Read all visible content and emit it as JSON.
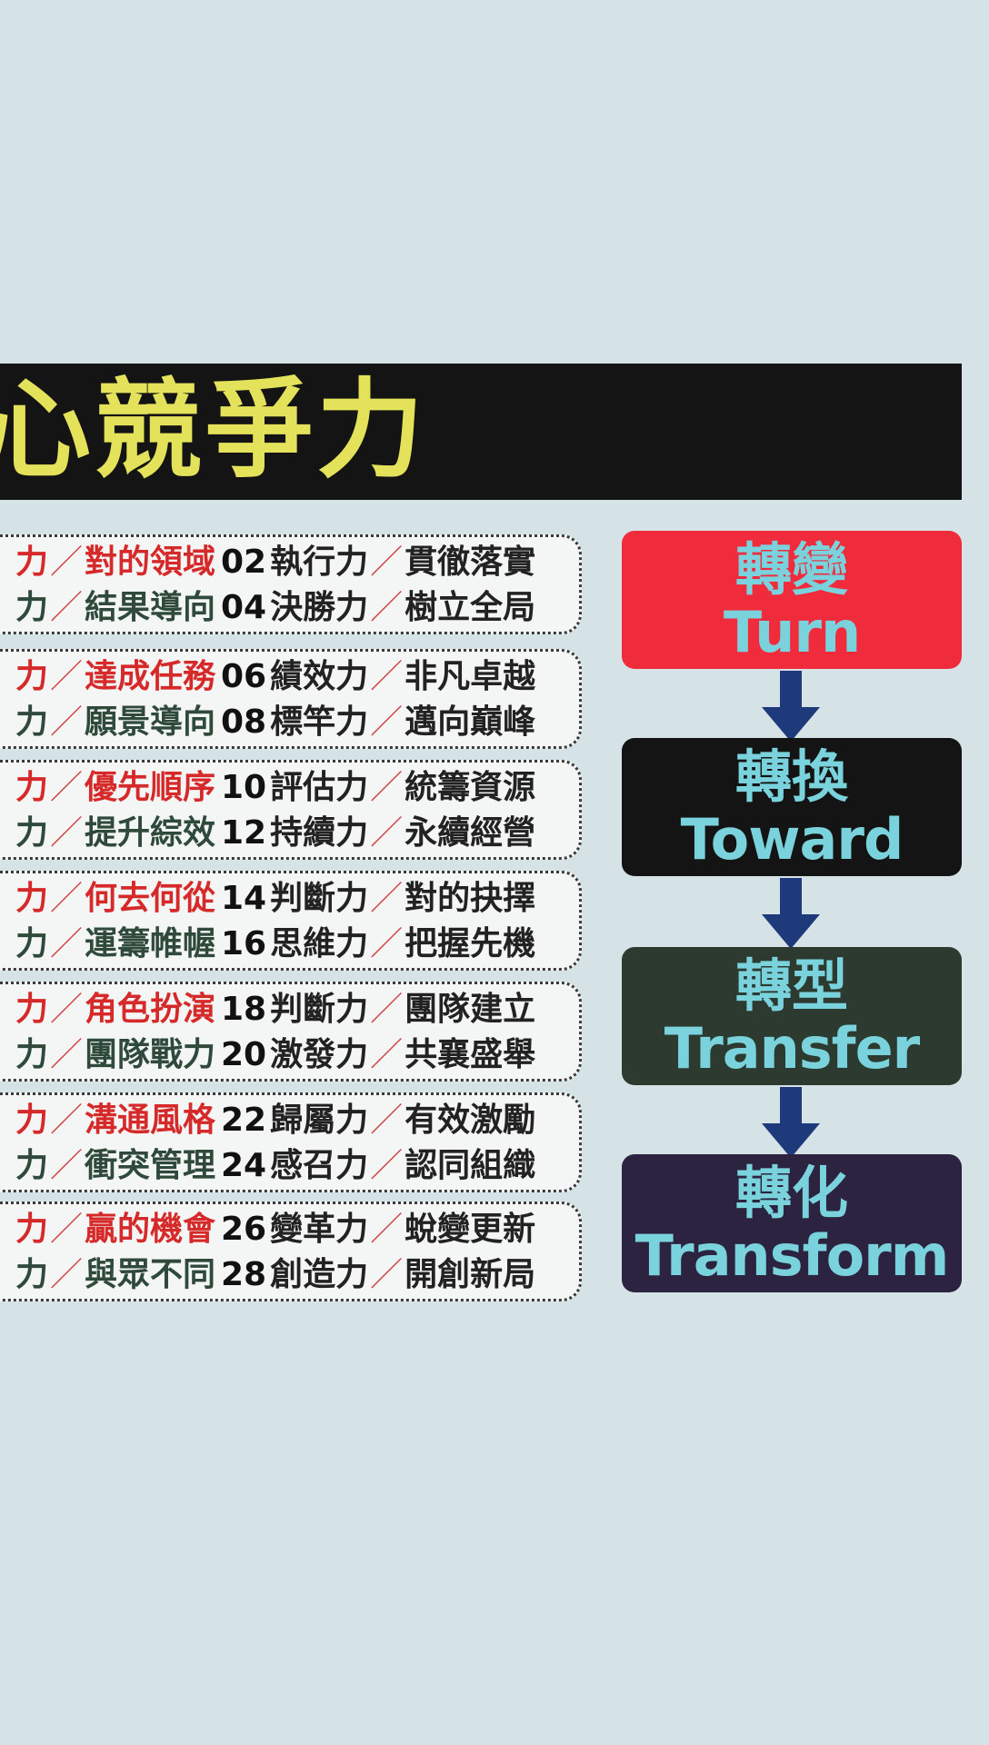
{
  "banner": {
    "title": "心競爭力"
  },
  "groups": [
    {
      "rows": [
        {
          "left_a": "力",
          "left_b": "對的領域",
          "left_color": "red",
          "num": "02",
          "right_a": "執行力",
          "right_b": "貫徹落實"
        },
        {
          "left_a": "力",
          "left_b": "結果導向",
          "left_color": "green",
          "num": "04",
          "right_a": "決勝力",
          "right_b": "樹立全局"
        }
      ]
    },
    {
      "rows": [
        {
          "left_a": "力",
          "left_b": "達成任務",
          "left_color": "red",
          "num": "06",
          "right_a": "績效力",
          "right_b": "非凡卓越"
        },
        {
          "left_a": "力",
          "left_b": "願景導向",
          "left_color": "green",
          "num": "08",
          "right_a": "標竿力",
          "right_b": "邁向巔峰"
        }
      ]
    },
    {
      "rows": [
        {
          "left_a": "力",
          "left_b": "優先順序",
          "left_color": "red",
          "num": "10",
          "right_a": "評估力",
          "right_b": "統籌資源"
        },
        {
          "left_a": "力",
          "left_b": "提升綜效",
          "left_color": "green",
          "num": "12",
          "right_a": "持續力",
          "right_b": "永續經營"
        }
      ]
    },
    {
      "rows": [
        {
          "left_a": "力",
          "left_b": "何去何從",
          "left_color": "red",
          "num": "14",
          "right_a": "判斷力",
          "right_b": "對的抉擇"
        },
        {
          "left_a": "力",
          "left_b": "運籌帷幄",
          "left_color": "green",
          "num": "16",
          "right_a": "思維力",
          "right_b": "把握先機"
        }
      ]
    },
    {
      "rows": [
        {
          "left_a": "力",
          "left_b": "角色扮演",
          "left_color": "red",
          "num": "18",
          "right_a": "判斷力",
          "right_b": "團隊建立"
        },
        {
          "left_a": "力",
          "left_b": "團隊戰力",
          "left_color": "green",
          "num": "20",
          "right_a": "激發力",
          "right_b": "共襄盛舉"
        }
      ]
    },
    {
      "rows": [
        {
          "left_a": "力",
          "left_b": "溝通風格",
          "left_color": "red",
          "num": "22",
          "right_a": "歸屬力",
          "right_b": "有效激勵"
        },
        {
          "left_a": "力",
          "left_b": "衝突管理",
          "left_color": "green",
          "num": "24",
          "right_a": "感召力",
          "right_b": "認同組織"
        }
      ]
    },
    {
      "rows": [
        {
          "left_a": "力",
          "left_b": "贏的機會",
          "left_color": "red",
          "num": "26",
          "right_a": "變革力",
          "right_b": "蛻變更新"
        },
        {
          "left_a": "力",
          "left_b": "與眾不同",
          "left_color": "green",
          "num": "28",
          "right_a": "創造力",
          "right_b": "開創新局"
        }
      ]
    }
  ],
  "flow": [
    {
      "zh": "轉變",
      "en": "Turn",
      "bg": "#ef2b3c"
    },
    {
      "zh": "轉換",
      "en": "Toward",
      "bg": "#141414"
    },
    {
      "zh": "轉型",
      "en": "Transfer",
      "bg": "#2c3a30"
    },
    {
      "zh": "轉化",
      "en": "Transform",
      "bg": "#2b2340"
    }
  ],
  "colors": {
    "background": "#d6e3e6",
    "banner": "#141414",
    "banner_text": "#e3e25a",
    "flow_text": "#7ad3dc",
    "arrow": "#1f3a7a",
    "red_text": "#d62a2a",
    "green_text": "#2f4a3a"
  },
  "sep": "／"
}
